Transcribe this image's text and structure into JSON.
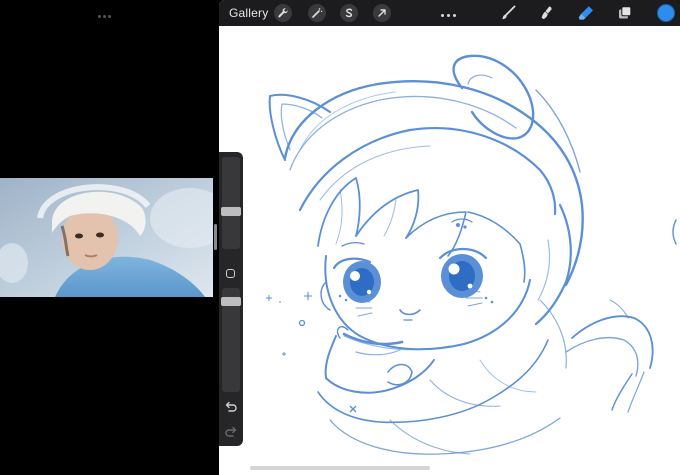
{
  "toolbar": {
    "gallery_label": "Gallery",
    "left_tools": [
      "wrench-icon",
      "magic-wand-icon",
      "selection-s-icon",
      "arrow-transform-icon"
    ],
    "right_tools": [
      "brush-icon",
      "smudge-icon",
      "eraser-icon",
      "layers-icon"
    ],
    "active_tool": "eraser-icon",
    "active_tool_color": "#2f8cea",
    "current_color": "#2f8cea"
  },
  "sidebar": {
    "brush_size_level": 0.5,
    "opacity_level": 0.52,
    "buttons": [
      "modify-square-icon",
      "undo-icon",
      "redo-icon"
    ]
  },
  "sketch": {
    "stroke_color": "#5b8fd6"
  }
}
